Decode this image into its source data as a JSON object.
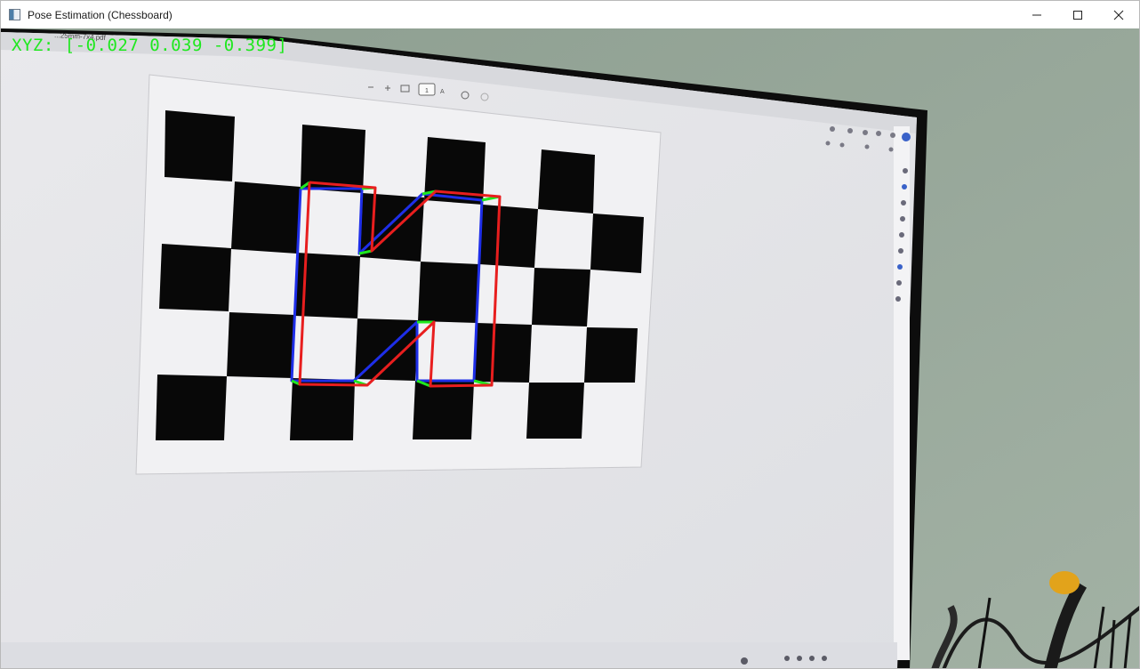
{
  "window": {
    "title": "Pose Estimation (Chessboard)",
    "icon": "app-window-icon",
    "controls": [
      "minimize-icon",
      "maximize-icon",
      "close-icon"
    ]
  },
  "overlay": {
    "xyz_text": "XYZ: [-0.027 0.039 -0.399]",
    "text_color": "#1fe81f"
  },
  "pdf_viewer": {
    "filename_fragment": "...25mm-7x4.pdf",
    "page_number": "1",
    "toolbar_icons": [
      "zoom-out-icon",
      "zoom-in-icon",
      "fit-page-icon",
      "page-number-box",
      "text-icon",
      "rotate-icon",
      "history-icon"
    ]
  },
  "scene": {
    "chessboard_pattern": "7x4",
    "axis_colors": {
      "x": "#e81e1e",
      "y": "#1fe81f",
      "z": "#1e2ee8"
    },
    "wall_color": "#9aaa9c",
    "monitor_bezel_color": "#111111"
  }
}
